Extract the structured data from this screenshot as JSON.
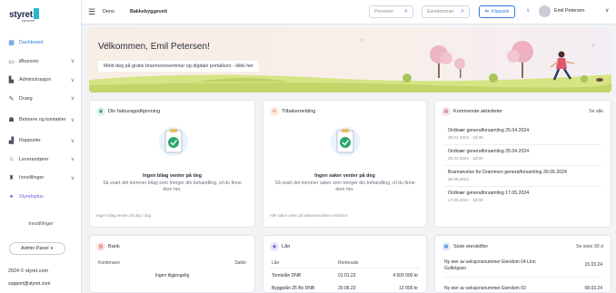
{
  "sidebar": {
    "logo": "styret",
    "logo_sub": "hjemmet",
    "items": [
      {
        "label": "Dashboard",
        "icon": "grid-icon",
        "glyph": "▦"
      },
      {
        "label": "Økonomi",
        "icon": "wallet-icon",
        "glyph": "▭"
      },
      {
        "label": "Administrasjon",
        "icon": "admin-icon",
        "glyph": "▙"
      },
      {
        "label": "Drang",
        "icon": "tool-icon",
        "glyph": "✎"
      },
      {
        "label": "Beboere og kontakter",
        "icon": "people-icon",
        "glyph": "☗"
      },
      {
        "label": "Rapporter",
        "icon": "chart-icon",
        "glyph": "▟"
      },
      {
        "label": "Leverandører",
        "icon": "building-icon",
        "glyph": "⌂"
      },
      {
        "label": "Innstillinger",
        "icon": "gear-icon",
        "glyph": "♜"
      },
      {
        "label": "Styretsplus",
        "icon": "plus-icon",
        "glyph": "✦"
      }
    ],
    "settings": "Innstillinger",
    "admin_button": "Admin Panel ∨",
    "copyright": "2024 © styret.com",
    "email": "support@styret.com"
  },
  "topbar": {
    "home": "Deno",
    "org": "Bakkebyggeveit",
    "search1_placeholder": "Personer",
    "search2_placeholder": "Eiendommer",
    "classic": "Klassisk",
    "user": "Emil Petersen"
  },
  "banner": {
    "welcome": "Velkommen, Emil Petersen!",
    "cta": "Meld deg på gratis brannvernseminar og digitale portalkurs - klikk her"
  },
  "card_approval": {
    "title": "Din fakturagodkjenning",
    "empty_title": "Ingen bilag venter på deg",
    "empty_text": "Så snart det kommer bilag som trenger din behandling, vil du finne dem her.",
    "footer": "Ingen bilag venter på deg i dag"
  },
  "card_requests": {
    "title": "Tilbakemelding",
    "empty_title": "Ingen saker venter på deg",
    "empty_text": "Så snart det kommer saker som trenger din behandling, vil du finne dem her.",
    "footer": "Alle saker vises på saksoversikten nedenfor"
  },
  "card_activities": {
    "title": "Kommende aktiviteter",
    "see_all": "Se alle",
    "items": [
      {
        "title": "Ordinær generalforsamling 25.04.2024",
        "date": "25.04.2024 · 18:00"
      },
      {
        "title": "Ordinær generalforsamling 25.04.2024",
        "date": "25.04.2024 · 18:00"
      },
      {
        "title": "Brannøvelse for Drammen generalforsamling 30.05.2024",
        "date": "30.05.2024"
      },
      {
        "title": "Ordinær generalforsamling 17.05.2024",
        "date": "17.05.2024 · 18:00"
      }
    ]
  },
  "card_bank": {
    "title": "Bank",
    "col1": "Kontonavn",
    "col2": "Saldo",
    "empty": "Ingen tilgjengelig"
  },
  "card_loans": {
    "title": "Lån",
    "col1": "Lån",
    "col2": "Rentesats",
    "col3": "",
    "rows": [
      {
        "name": "Tomtelån DNB",
        "rate": "01.01.23",
        "amount": "4 500 000 kr"
      },
      {
        "name": "Byggelån 25 Bo DNB",
        "rate": "20.06.23",
        "amount": "12 000 kr"
      }
    ]
  },
  "card_assets": {
    "title": "Siste eierskifter",
    "see_all": "Se siste 30 d",
    "rows": [
      {
        "text": "Ny eier av seksjonsnummer Eiendom 04 Linn Gulbrigsen",
        "value": "15.03.24"
      },
      {
        "text": "Ny eier av seksjonsnummer Eiendom 03",
        "value": "08.03.24"
      }
    ]
  },
  "colors": {
    "accent": "#2f7fd6",
    "approve_green": "#2da66a",
    "banner_grass": "#cfe07a"
  }
}
